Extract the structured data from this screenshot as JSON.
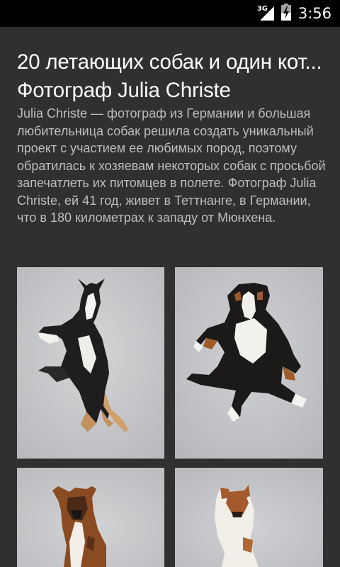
{
  "status_bar": {
    "network_label": "3G",
    "time": "3:56",
    "icons": [
      "signal-icon",
      "battery-charging-icon"
    ]
  },
  "article": {
    "title": "20 летающих собак и один кот... Фотограф Julia Christe",
    "description": "Julia Christe — фотограф из Германии и большая любительница собак решила создать уникальный проект с участием ее любимых пород, поэтому обратилась к хозяевам некоторых собак с просьбой запечатлеть их питомцев в полете. Фотограф Julia Christe, ей 41 год, живет в Теттнанге, в Германии, что в 180 километрах к западу от Мюнхена."
  },
  "photos": [
    {
      "subject": "border-collie-dog"
    },
    {
      "subject": "bernese-mountain-dog"
    },
    {
      "subject": "boxer-dog"
    },
    {
      "subject": "jack-russell-terrier-dog"
    }
  ],
  "colors": {
    "background": "#303030",
    "status_bar": "#000000",
    "title_text": "#ffffff",
    "body_text": "#bdbdbd"
  }
}
